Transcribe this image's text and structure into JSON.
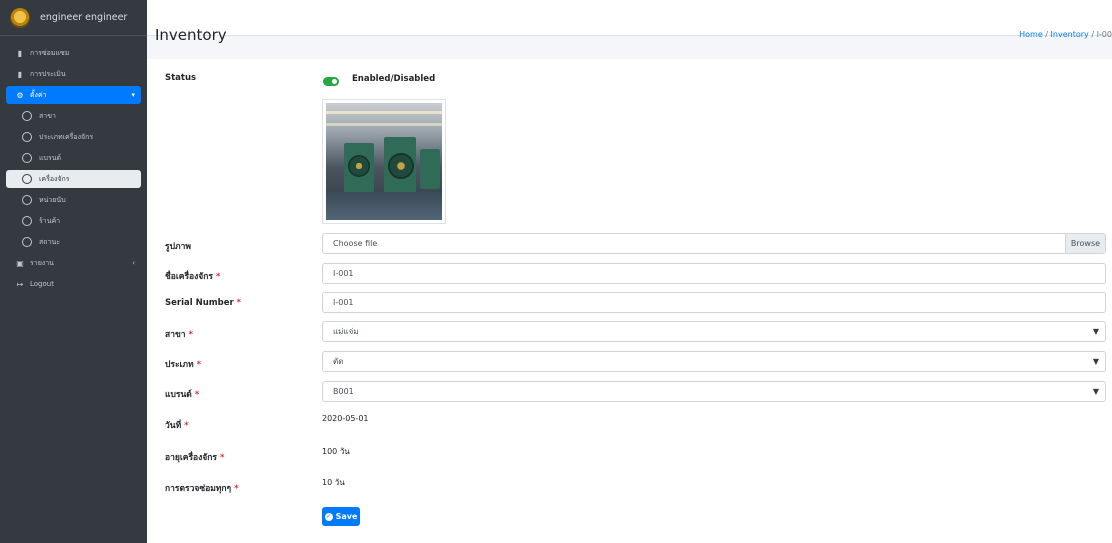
{
  "sidebar": {
    "user_name": "engineer engineer",
    "items": [
      {
        "label": "การซ่อมแซม",
        "icon": "file-icon"
      },
      {
        "label": "การประเมิน",
        "icon": "clipboard-check-icon"
      },
      {
        "label": "ตั้งค่า",
        "icon": "gear-icon",
        "active": true
      },
      {
        "label": "สาขา",
        "icon": "circle-icon"
      },
      {
        "label": "ประเภทเครื่องจักร",
        "icon": "circle-icon"
      },
      {
        "label": "แบรนด์",
        "icon": "circle-icon"
      },
      {
        "label": "เครื่องจักร",
        "icon": "circle-icon",
        "selected": true
      },
      {
        "label": "หน่วยนับ",
        "icon": "circle-icon"
      },
      {
        "label": "ร้านค้า",
        "icon": "circle-icon"
      },
      {
        "label": "สถานะ",
        "icon": "circle-icon"
      },
      {
        "label": "รายงาน",
        "icon": "report-icon"
      },
      {
        "label": "Logout",
        "icon": "logout-icon"
      }
    ]
  },
  "header": {
    "title": "Inventory",
    "breadcrumb": [
      "Home",
      "Inventory",
      "I-00"
    ]
  },
  "form": {
    "status_label": "Status",
    "status_text": "Enabled/Disabled",
    "status_enabled": true,
    "image_label": "รูปภาพ",
    "file_placeholder": "Choose file",
    "browse_label": "Browse",
    "machine_name_label": "ชื่อเครื่องจักร",
    "machine_name_value": "I-001",
    "serial_label": "Serial Number",
    "serial_value": "I-001",
    "branch_label": "สาขา",
    "branch_value": "แม่แจ่ม",
    "type_label": "ประเภท",
    "type_value": "ตัด",
    "brand_label": "แบรนด์",
    "brand_value": "B001",
    "date_label": "วันที่",
    "date_value": "2020-05-01",
    "age_label": "อายุเครื่องจักร",
    "age_value": "100 วัน",
    "maintenance_label": "การตรวจซ่อมทุกๆ",
    "maintenance_value": "10 วัน",
    "save_label": "Save",
    "required_mark": "*"
  },
  "colors": {
    "sidebar_bg": "#343a40",
    "accent": "#007bff",
    "toggle_on": "#28a745",
    "required": "#dc3545"
  }
}
